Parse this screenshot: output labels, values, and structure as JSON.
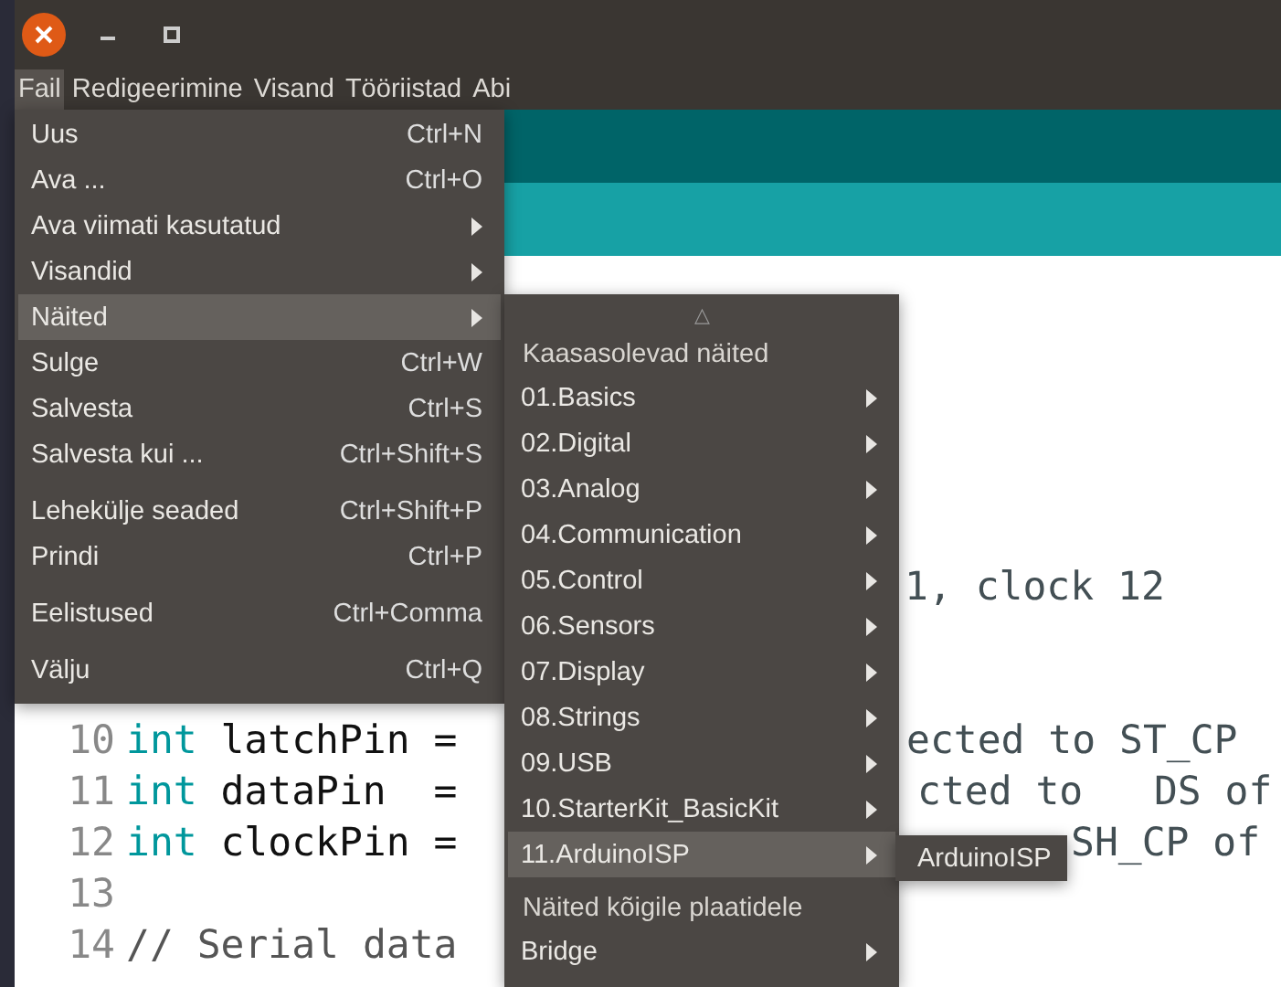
{
  "menubar": [
    {
      "label": "Fail",
      "selected": true
    },
    {
      "label": "Redigeerimine",
      "selected": false
    },
    {
      "label": "Visand",
      "selected": false
    },
    {
      "label": "Tööriistad",
      "selected": false
    },
    {
      "label": "Abi",
      "selected": false
    }
  ],
  "file_menu": [
    {
      "kind": "shortcut",
      "label": "Uus",
      "shortcut": "Ctrl+N",
      "selected": false
    },
    {
      "kind": "shortcut",
      "label": "Ava ...",
      "shortcut": "Ctrl+O",
      "selected": false
    },
    {
      "kind": "submenu",
      "label": "Ava viimati kasutatud",
      "selected": false
    },
    {
      "kind": "submenu",
      "label": "Visandid",
      "selected": false
    },
    {
      "kind": "submenu",
      "label": "Näited",
      "selected": true
    },
    {
      "kind": "shortcut",
      "label": "Sulge",
      "shortcut": "Ctrl+W",
      "selected": false
    },
    {
      "kind": "shortcut",
      "label": "Salvesta",
      "shortcut": "Ctrl+S",
      "selected": false
    },
    {
      "kind": "shortcut",
      "label": "Salvesta kui ...",
      "shortcut": "Ctrl+Shift+S",
      "selected": false
    },
    {
      "kind": "separator"
    },
    {
      "kind": "shortcut",
      "label": "Lehekülje seaded",
      "shortcut": "Ctrl+Shift+P",
      "selected": false
    },
    {
      "kind": "shortcut",
      "label": "Prindi",
      "shortcut": "Ctrl+P",
      "selected": false
    },
    {
      "kind": "separator"
    },
    {
      "kind": "shortcut",
      "label": "Eelistused",
      "shortcut": "Ctrl+Comma",
      "selected": false
    },
    {
      "kind": "separator"
    },
    {
      "kind": "shortcut",
      "label": "Välju",
      "shortcut": "Ctrl+Q",
      "selected": false
    }
  ],
  "examples_menu": [
    {
      "kind": "scroll-up",
      "label": "△"
    },
    {
      "kind": "header",
      "label": "Kaasasolevad näited"
    },
    {
      "kind": "submenu",
      "label": "01.Basics",
      "selected": false
    },
    {
      "kind": "submenu",
      "label": "02.Digital",
      "selected": false
    },
    {
      "kind": "submenu",
      "label": "03.Analog",
      "selected": false
    },
    {
      "kind": "submenu",
      "label": "04.Communication",
      "selected": false
    },
    {
      "kind": "submenu",
      "label": "05.Control",
      "selected": false
    },
    {
      "kind": "submenu",
      "label": "06.Sensors",
      "selected": false
    },
    {
      "kind": "submenu",
      "label": "07.Display",
      "selected": false
    },
    {
      "kind": "submenu",
      "label": "08.Strings",
      "selected": false
    },
    {
      "kind": "submenu",
      "label": "09.USB",
      "selected": false
    },
    {
      "kind": "submenu",
      "label": "10.StarterKit_BasicKit",
      "selected": false
    },
    {
      "kind": "submenu",
      "label": "11.ArduinoISP",
      "selected": true
    },
    {
      "kind": "separator"
    },
    {
      "kind": "header",
      "label": "Näited kõigile plaatidele"
    },
    {
      "kind": "submenu",
      "label": "Bridge",
      "selected": false
    }
  ],
  "isp_menu": [
    {
      "label": "ArduinoISP",
      "selected": false
    }
  ],
  "editor": {
    "lines": [
      {
        "tail": "1, clock 12"
      },
      {
        "number": "10",
        "tokens": [
          {
            "kind": "keyword",
            "text": "int"
          },
          {
            "kind": "plain",
            "text": "latchPin ="
          }
        ],
        "tail": "ected to ST_CP"
      },
      {
        "number": "11",
        "tokens": [
          {
            "kind": "keyword",
            "text": "int"
          },
          {
            "kind": "plain",
            "text": "dataPin  ="
          }
        ],
        "tail": "cted to   DS of"
      },
      {
        "number": "12",
        "tokens": [
          {
            "kind": "keyword",
            "text": "int"
          },
          {
            "kind": "plain",
            "text": "clockPin ="
          }
        ],
        "tail": "SH_CP of"
      },
      {
        "number": "13"
      },
      {
        "number": "14",
        "tokens": [
          {
            "kind": "comment",
            "text": "// Serial data"
          }
        ]
      }
    ]
  }
}
